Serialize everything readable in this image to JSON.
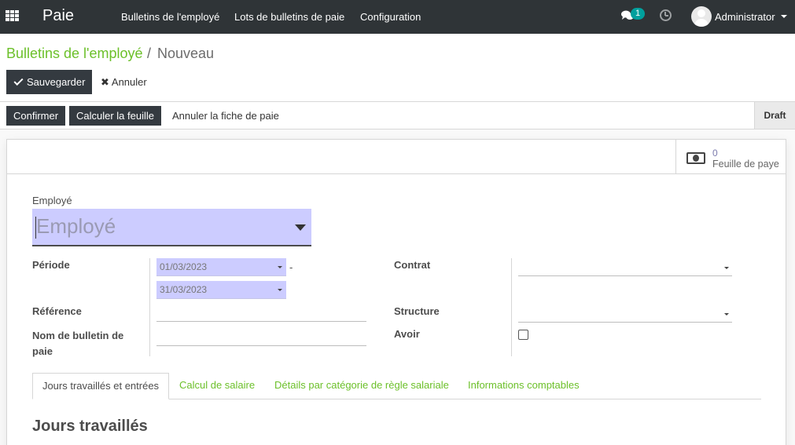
{
  "navbar": {
    "brand": "Paie",
    "menu": [
      "Bulletins de l'employé",
      "Lots de bulletins de paie",
      "Configuration"
    ],
    "messages_badge": "1",
    "user": "Administrator"
  },
  "breadcrumb": {
    "parent": "Bulletins de l'employé",
    "separator": "/",
    "current": "Nouveau"
  },
  "actions": {
    "save": "Sauvegarder",
    "discard": "Annuler"
  },
  "statusbar": {
    "buttons": [
      "Confirmer",
      "Calculer la feuille"
    ],
    "link": "Annuler la fiche de paie",
    "state": "Draft"
  },
  "stat_button": {
    "value": "0",
    "label": "Feuille de paye"
  },
  "form": {
    "employee_label": "Employé",
    "employee_placeholder": "Employé",
    "period_label": "Période",
    "date_from": "01/03/2023",
    "date_to": "31/03/2023",
    "date_separator": "-",
    "reference_label": "Référence",
    "name_label": "Nom de bulletin de paie",
    "contract_label": "Contrat",
    "structure_label": "Structure",
    "credit_note_label": "Avoir"
  },
  "tabs": [
    "Jours travaillés et entrées",
    "Calcul de salaire",
    "Détails par catégorie de règle salariale",
    "Informations comptables"
  ],
  "section_title": "Jours travaillés",
  "colors": {
    "navbar": "#2f3437",
    "accent_green": "#6cc02a",
    "required_field": "#ccccff",
    "badge": "#00a09d"
  }
}
